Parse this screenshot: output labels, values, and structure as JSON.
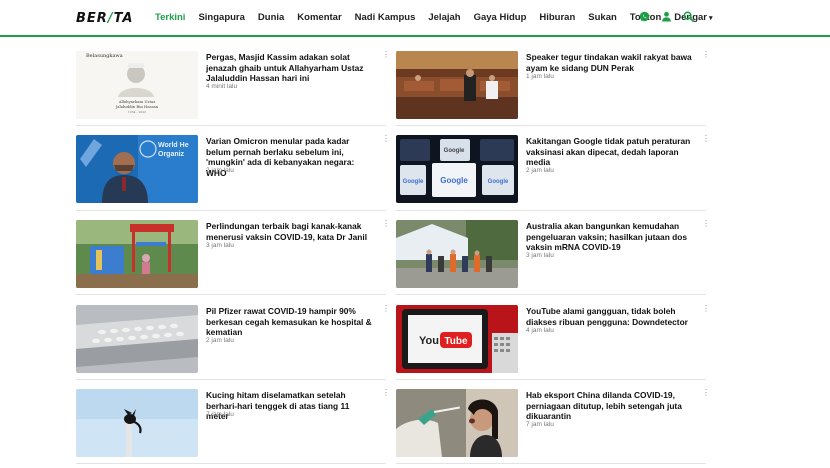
{
  "header": {
    "logo": {
      "left": "BER",
      "slash": "/",
      "right": "TA"
    },
    "nav": [
      {
        "label": "Terkini",
        "active": true
      },
      {
        "label": "Singapura"
      },
      {
        "label": "Dunia"
      },
      {
        "label": "Komentar"
      },
      {
        "label": "Nadi Kampus"
      },
      {
        "label": "Jelajah"
      },
      {
        "label": "Gaya Hidup"
      },
      {
        "label": "Hiburan"
      },
      {
        "label": "Sukan"
      },
      {
        "label": "Tonton"
      },
      {
        "label": "Dengar",
        "dropdown": true
      }
    ],
    "icons": [
      "whatsapp-icon",
      "user-icon",
      "search-icon"
    ],
    "accent": "#1f9e4a"
  },
  "articles": [
    {
      "title": "Pergas, Masjid Kassim adakan solat jenazah ghaib untuk Allahyarham Ustaz Jalaluddin Hassan hari ini",
      "time": "4 minit lalu",
      "thumb": "memorial",
      "thumb_text": {
        "top": "Belasungkawa",
        "name1": "Allahyarham Ustaz",
        "name2": "Jalaluddin Bin Hassan",
        "years": "1954 - 2022"
      }
    },
    {
      "title": "Speaker tegur tindakan wakil rakyat bawa ayam ke sidang DUN Perak",
      "time": "1 jam lalu",
      "thumb": "parliament"
    },
    {
      "title": "Varian Omicron menular pada kadar belum pernah berlaku sebelum ini, 'mungkin' ada di kebanyakan negara: WHO",
      "time": "2 jam lalu",
      "thumb": "who",
      "thumb_text": {
        "line1": "World He",
        "line2": "Organiz"
      }
    },
    {
      "title": "Kakitangan Google tidak patuh peraturan vaksinasi akan dipecat, dedah laporan media",
      "time": "2 jam lalu",
      "thumb": "google",
      "thumb_text": {
        "brand": "Google"
      }
    },
    {
      "title": "Perlindungan terbaik bagi kanak-kanak menerusi vaksin COVID-19, kata Dr Janil",
      "time": "3 jam lalu",
      "thumb": "playground"
    },
    {
      "title": "Australia akan bangunkan kemudahan pengeluaran vaksin; hasilkan jutaan dos vaksin mRNA COVID-19",
      "time": "3 jam lalu",
      "thumb": "queue"
    },
    {
      "title": "Pil Pfizer rawat COVID-19 hampir 90% berkesan cegah kemasukan ke hospital & kematian",
      "time": "2 jam lalu",
      "thumb": "pills"
    },
    {
      "title": "YouTube alami gangguan, tidak boleh diakses ribuan pengguna: Downdetector",
      "time": "4 jam lalu",
      "thumb": "youtube",
      "thumb_text": {
        "brand1": "You",
        "brand2": "Tube"
      }
    },
    {
      "title": "Kucing hitam diselamatkan setelah berhari-hari tenggek di atas tiang 11 meter",
      "time": "7 jam lalu",
      "thumb": "cat"
    },
    {
      "title": "Hab eksport China dilanda COVID-19, perniagaan ditutup, lebih setengah juta dikuarantin",
      "time": "7 jam lalu",
      "thumb": "swab"
    }
  ]
}
